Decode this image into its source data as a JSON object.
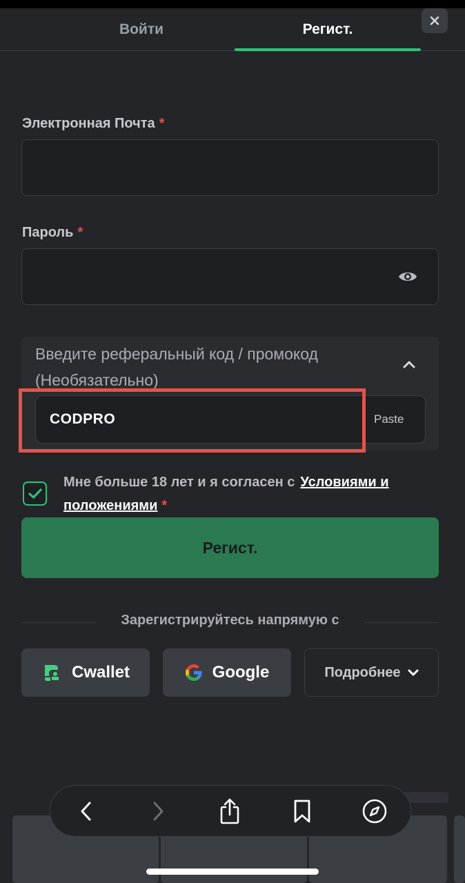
{
  "tabs": {
    "login_label": "Войти",
    "register_label": "Регист."
  },
  "form": {
    "email_label": "Электронная Почта",
    "password_label": "Пароль",
    "required_mark": "*",
    "email_value": "",
    "password_value": ""
  },
  "promo": {
    "title": "Введите реферальный код / промокод (Необязательно)",
    "code_value": "CODPRO",
    "paste_label": "Paste",
    "highlight_color": "#e8524a"
  },
  "terms": {
    "checked": true,
    "text": "Мне больше 18 лет и я согласен с",
    "link_label": "Условиями и положениями"
  },
  "register_button_label": "Регист.",
  "social": {
    "divider_text": "Зарегистрируйтесь напрямую с",
    "cwallet_label": "Cwallet",
    "google_label": "Google",
    "more_label": "Подробнее"
  },
  "colors": {
    "accent": "#2ec27a",
    "background": "#232528",
    "button": "#2b7a52"
  },
  "browser_toolbar": {
    "icons": [
      "back-icon",
      "forward-icon",
      "share-icon",
      "bookmarks-icon",
      "safari-compass-icon"
    ]
  }
}
